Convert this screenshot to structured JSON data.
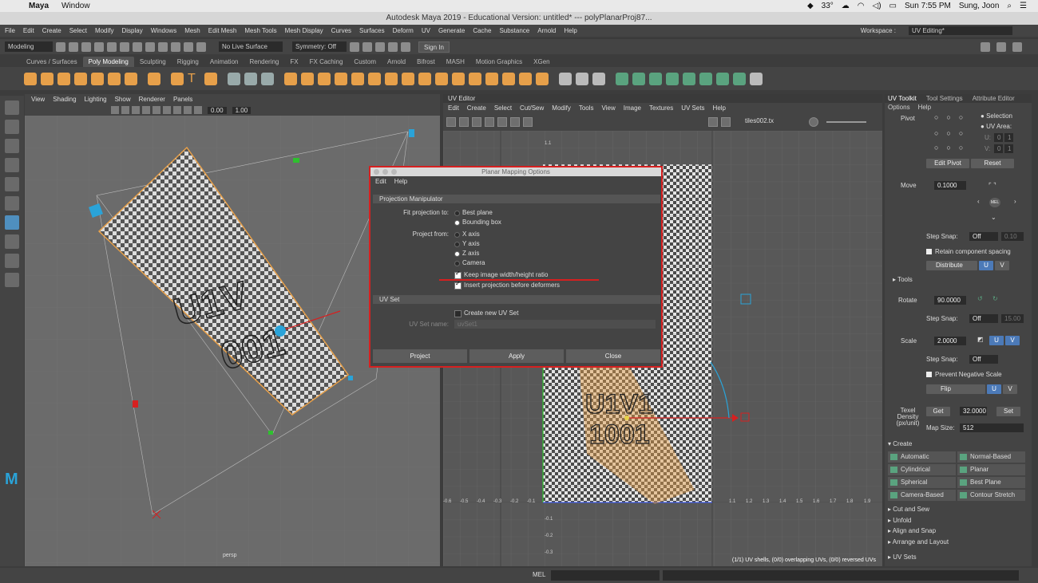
{
  "macbar": {
    "app": "Maya",
    "menu": [
      "Window"
    ],
    "temp": "33°",
    "clock": "Sun 7:55 PM",
    "user": "Sung, Joon"
  },
  "title": "Autodesk Maya 2019 - Educational Version: untitled*  ---  polyPlanarProj87...",
  "main_menu": [
    "File",
    "Edit",
    "Create",
    "Select",
    "Modify",
    "Display",
    "Windows",
    "Mesh",
    "Edit Mesh",
    "Mesh Tools",
    "Mesh Display",
    "Curves",
    "Surfaces",
    "Deform",
    "UV",
    "Generate",
    "Cache",
    "Substance",
    "Arnold",
    "Help"
  ],
  "workspace": {
    "label": "Workspace :",
    "value": "UV Editing*"
  },
  "status_line": {
    "mode": "Modeling",
    "live_surface": "No Live Surface",
    "symmetry": "Symmetry: Off",
    "sign_in": "Sign In"
  },
  "shelf_tabs": [
    "Curves / Surfaces",
    "Poly Modeling",
    "Sculpting",
    "Rigging",
    "Animation",
    "Rendering",
    "FX",
    "FX Caching",
    "Custom",
    "Arnold",
    "Bifrost",
    "MASH",
    "Motion Graphics",
    "XGen"
  ],
  "shelf_active": "Poly Modeling",
  "viewport": {
    "menu": [
      "View",
      "Shading",
      "Lighting",
      "Show",
      "Renderer",
      "Panels"
    ],
    "val1": "0.00",
    "val2": "1.00",
    "camera": "persp",
    "plane_text1": "U1V",
    "plane_text2": "001"
  },
  "uv_editor": {
    "title": "UV Editor",
    "menu": [
      "Edit",
      "Create",
      "Select",
      "Cut/Sew",
      "Modify",
      "Tools",
      "View",
      "Image",
      "Textures",
      "UV Sets",
      "Help"
    ],
    "texture": "tiles002.tx",
    "tile_text1": "U1V1",
    "tile_text2": "1001",
    "status": "(1/1) UV shells, (0/0) overlapping UVs, (0/0) reversed UVs",
    "ticks_x": [
      "-0.6",
      "-0.5",
      "-0.4",
      "-0.3",
      "-0.2",
      "-0.1",
      "1.1",
      "1.2",
      "1.3",
      "1.4",
      "1.5",
      "1.6",
      "1.7",
      "1.8",
      "1.9"
    ],
    "ticks_y": [
      "1.1",
      "-0.1",
      "-0.2",
      "-0.3"
    ]
  },
  "right_panel": {
    "tabs": [
      "UV Toolkit",
      "Tool Settings",
      "Attribute Editor"
    ],
    "menu": [
      "Options",
      "Help"
    ],
    "pivot_label": "Pivot",
    "selection": "Selection",
    "uv_area": "UV Area:",
    "u_label": "U:",
    "v_label": "V:",
    "u_val1": "0",
    "u_val2": "1",
    "v_val1": "0",
    "v_val2": "1",
    "edit_pivot": "Edit Pivot",
    "reset": "Reset",
    "move_label": "Move",
    "move_val": "0.1000",
    "mel_btn": "MEL",
    "step_snap": "Step Snap:",
    "off": "Off",
    "move_step_val": "0.10",
    "rotate_step_val": "15.00",
    "retain": "Retain component spacing",
    "distribute": "Distribute",
    "u": "U",
    "v": "V",
    "tools": "Tools",
    "rotate_label": "Rotate",
    "rotate_val": "90.0000",
    "scale_label": "Scale",
    "scale_val": "2.0000",
    "prevent_negative": "Prevent Negative Scale",
    "flip": "Flip",
    "texel_label": "Texel Density (px/unit)",
    "get": "Get",
    "texel_val": "32.0000",
    "set": "Set",
    "map_size_label": "Map Size:",
    "map_size": "512",
    "create": "Create",
    "create_buttons": [
      "Automatic",
      "Normal-Based",
      "Cylindrical",
      "Planar",
      "Spherical",
      "Best Plane",
      "Camera-Based",
      "Contour Stretch"
    ],
    "sections": [
      "Cut and Sew",
      "Unfold",
      "Align and Snap",
      "Arrange and Layout",
      "UV Sets"
    ]
  },
  "command_line": {
    "label": "MEL"
  },
  "dialog": {
    "title": "Planar Mapping Options",
    "menu": [
      "Edit",
      "Help"
    ],
    "frame1": "Projection Manipulator",
    "fit_label": "Fit projection to:",
    "best_plane": "Best plane",
    "bounding_box": "Bounding box",
    "project_from_label": "Project from:",
    "x_axis": "X axis",
    "y_axis": "Y axis",
    "z_axis": "Z axis",
    "camera": "Camera",
    "keep_ratio": "Keep image width/height ratio",
    "insert_projection": "Insert projection before deformers",
    "frame2": "UV Set",
    "create_new": "Create new UV Set",
    "uvset_name_label": "UV Set name:",
    "uvset_name": "uvSet1",
    "buttons": [
      "Project",
      "Apply",
      "Close"
    ]
  },
  "colors": {
    "accent_blue": "#4c7ab8",
    "highlight_red": "#d62020",
    "orange": "#e7a04a"
  }
}
